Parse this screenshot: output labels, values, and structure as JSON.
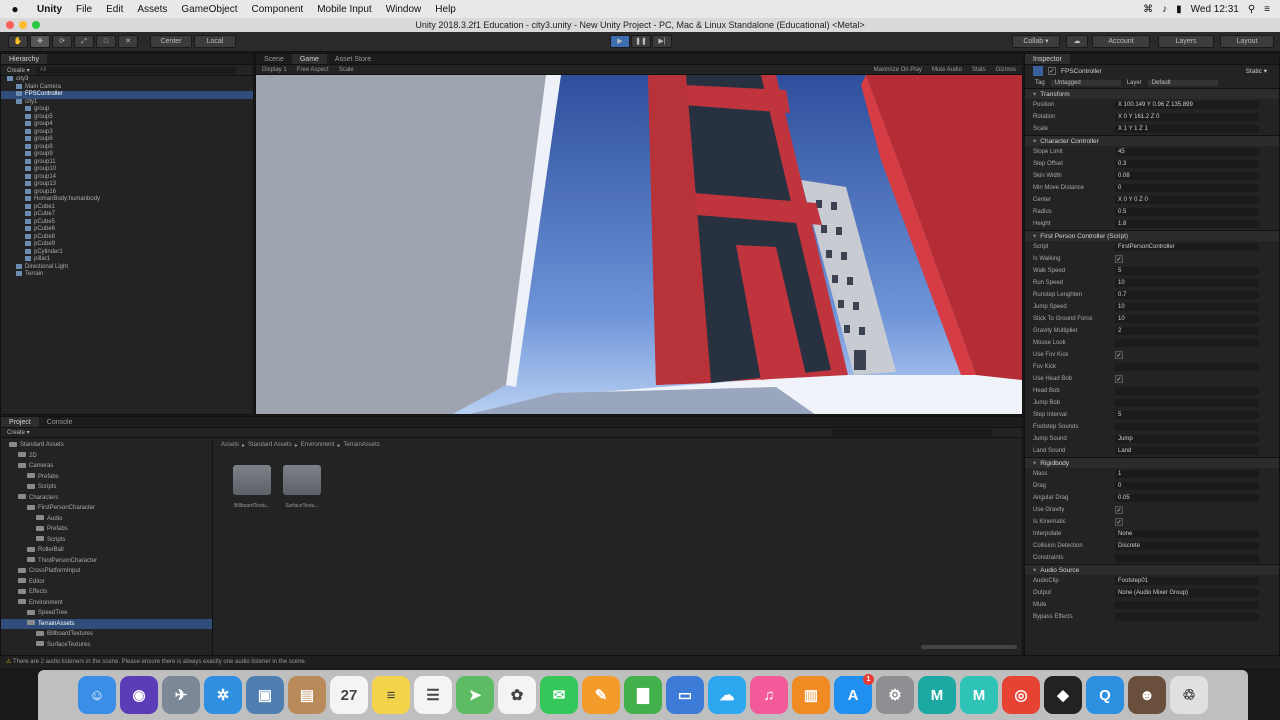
{
  "menubar": {
    "apple": "",
    "app": "Unity",
    "items": [
      "File",
      "Edit",
      "Assets",
      "GameObject",
      "Component",
      "Mobile Input",
      "Window",
      "Help"
    ],
    "clock": "Wed 12:31"
  },
  "window": {
    "title": "Unity 2018.3.2f1 Education - city3.unity - New Unity Project - PC, Mac & Linux Standalone (Educational) <Metal>"
  },
  "toolbar": {
    "center_label": "Center",
    "local_label": "Local",
    "collab_label": "Collab ▾",
    "account_label": "Account",
    "layers_label": "Layers",
    "layout_label": "Layout"
  },
  "hierarchy": {
    "tab": "Hierarchy",
    "create": "Create ▾",
    "search_placeholder": "All",
    "items": [
      {
        "label": "city3",
        "indent": 0,
        "selected": false
      },
      {
        "label": "Main Camera",
        "indent": 1,
        "selected": false
      },
      {
        "label": "FPSController",
        "indent": 1,
        "selected": true
      },
      {
        "label": "city1",
        "indent": 1,
        "selected": false
      },
      {
        "label": "group",
        "indent": 2,
        "selected": false
      },
      {
        "label": "group5",
        "indent": 2,
        "selected": false
      },
      {
        "label": "group4",
        "indent": 2,
        "selected": false
      },
      {
        "label": "group3",
        "indent": 2,
        "selected": false
      },
      {
        "label": "group6",
        "indent": 2,
        "selected": false
      },
      {
        "label": "group8",
        "indent": 2,
        "selected": false
      },
      {
        "label": "group9",
        "indent": 2,
        "selected": false
      },
      {
        "label": "group11",
        "indent": 2,
        "selected": false
      },
      {
        "label": "group10",
        "indent": 2,
        "selected": false
      },
      {
        "label": "group14",
        "indent": 2,
        "selected": false
      },
      {
        "label": "group13",
        "indent": 2,
        "selected": false
      },
      {
        "label": "group16",
        "indent": 2,
        "selected": false
      },
      {
        "label": "HumanBody:humanbody",
        "indent": 2,
        "selected": false
      },
      {
        "label": "pCube1",
        "indent": 2,
        "selected": false
      },
      {
        "label": "pCube7",
        "indent": 2,
        "selected": false
      },
      {
        "label": "pCube5",
        "indent": 2,
        "selected": false
      },
      {
        "label": "pCube6",
        "indent": 2,
        "selected": false
      },
      {
        "label": "pCube8",
        "indent": 2,
        "selected": false
      },
      {
        "label": "pCube9",
        "indent": 2,
        "selected": false
      },
      {
        "label": "pCylinder1",
        "indent": 2,
        "selected": false
      },
      {
        "label": "pillar1",
        "indent": 2,
        "selected": false
      },
      {
        "label": "Directional Light",
        "indent": 1,
        "selected": false
      },
      {
        "label": "Terrain",
        "indent": 1,
        "selected": false
      }
    ]
  },
  "sceneview": {
    "tabs": [
      "Scene",
      "Game",
      "Asset Store"
    ],
    "active_tab": "Game",
    "display": "Display 1",
    "aspect": "Free Aspect",
    "scale_label": "Scale",
    "maximize": "Maximize On Play",
    "mute": "Mute Audio",
    "stats": "Stats",
    "gizmos": "Gizmos"
  },
  "project": {
    "tabs": [
      "Project",
      "Console"
    ],
    "create": "Create ▾",
    "tree": [
      {
        "label": "Standard Assets",
        "indent": 0
      },
      {
        "label": "2D",
        "indent": 1
      },
      {
        "label": "Cameras",
        "indent": 1
      },
      {
        "label": "Prefabs",
        "indent": 2
      },
      {
        "label": "Scripts",
        "indent": 2
      },
      {
        "label": "Characters",
        "indent": 1
      },
      {
        "label": "FirstPersonCharacter",
        "indent": 2
      },
      {
        "label": "Audio",
        "indent": 3
      },
      {
        "label": "Prefabs",
        "indent": 3
      },
      {
        "label": "Scripts",
        "indent": 3
      },
      {
        "label": "RollerBall",
        "indent": 2
      },
      {
        "label": "ThirdPersonCharacter",
        "indent": 2
      },
      {
        "label": "CrossPlatformInput",
        "indent": 1
      },
      {
        "label": "Editor",
        "indent": 1
      },
      {
        "label": "Effects",
        "indent": 1
      },
      {
        "label": "Environment",
        "indent": 1
      },
      {
        "label": "SpeedTree",
        "indent": 2
      },
      {
        "label": "TerrainAssets",
        "indent": 2
      },
      {
        "label": "BillboardTextures",
        "indent": 3
      },
      {
        "label": "SurfaceTextures",
        "indent": 3
      }
    ],
    "breadcrumb": [
      "Assets",
      "Standard Assets",
      "Environment",
      "TerrainAssets"
    ],
    "folders": [
      "BillboardTextu...",
      "SurfaceTextu..."
    ]
  },
  "status": {
    "message": "There are 2 audio listeners in the scene. Please ensure there is always exactly one audio listener in the scene."
  },
  "inspector": {
    "tab": "Inspector",
    "object_name": "FPSController",
    "static": "Static ▾",
    "tag_label": "Tag",
    "tag_value": "Untagged",
    "layer_label": "Layer",
    "layer_value": "Default",
    "components": [
      {
        "title": "Transform",
        "rows": [
          {
            "label": "Position",
            "value": "X 100.149   Y 0.96    Z 135.899"
          },
          {
            "label": "Rotation",
            "value": "X 0       Y 161.2   Z 0"
          },
          {
            "label": "Scale",
            "value": "X 1       Y 1       Z 1"
          }
        ]
      },
      {
        "title": "Character Controller",
        "rows": [
          {
            "label": "Slope Limit",
            "value": "45"
          },
          {
            "label": "Step Offset",
            "value": "0.3"
          },
          {
            "label": "Skin Width",
            "value": "0.08"
          },
          {
            "label": "Min Move Distance",
            "value": "0"
          },
          {
            "label": "Center",
            "value": "X 0       Y 0       Z 0"
          },
          {
            "label": "Radius",
            "value": "0.5"
          },
          {
            "label": "Height",
            "value": "1.8"
          }
        ]
      },
      {
        "title": "First Person Controller (Script)",
        "rows": [
          {
            "label": "Script",
            "value": "FirstPersonController"
          },
          {
            "label": "Is Walking",
            "value": "✓",
            "check": true
          },
          {
            "label": "Walk Speed",
            "value": "5"
          },
          {
            "label": "Run Speed",
            "value": "10"
          },
          {
            "label": "Runstep Lenghten",
            "value": "0.7"
          },
          {
            "label": "Jump Speed",
            "value": "10"
          },
          {
            "label": "Stick To Ground Force",
            "value": "10"
          },
          {
            "label": "Gravity Multiplier",
            "value": "2"
          },
          {
            "label": "Mouse Look",
            "value": ""
          },
          {
            "label": "Use Fov Kick",
            "value": "✓",
            "check": true
          },
          {
            "label": "Fov Kick",
            "value": ""
          },
          {
            "label": "Use Head Bob",
            "value": "✓",
            "check": true
          },
          {
            "label": "Head Bob",
            "value": ""
          },
          {
            "label": "Jump Bob",
            "value": ""
          },
          {
            "label": "Step Interval",
            "value": "5"
          },
          {
            "label": "Footstep Sounds",
            "value": ""
          },
          {
            "label": "Jump Sound",
            "value": "Jump"
          },
          {
            "label": "Land Sound",
            "value": "Land"
          }
        ]
      },
      {
        "title": "Rigidbody",
        "rows": [
          {
            "label": "Mass",
            "value": "1"
          },
          {
            "label": "Drag",
            "value": "0"
          },
          {
            "label": "Angular Drag",
            "value": "0.05"
          },
          {
            "label": "Use Gravity",
            "value": "✓",
            "check": true
          },
          {
            "label": "Is Kinematic",
            "value": "✓",
            "check": true
          },
          {
            "label": "Interpolate",
            "value": "None"
          },
          {
            "label": "Collision Detection",
            "value": "Discrete"
          },
          {
            "label": "Constraints",
            "value": ""
          }
        ]
      },
      {
        "title": "Audio Source",
        "rows": [
          {
            "label": "AudioClip",
            "value": "Footstep01"
          },
          {
            "label": "Output",
            "value": "None (Audio Mixer Group)"
          },
          {
            "label": "Mute",
            "value": ""
          },
          {
            "label": "Bypass Effects",
            "value": ""
          }
        ]
      }
    ]
  },
  "dock": {
    "icons": [
      {
        "name": "finder-icon",
        "color": "#3a8ee6",
        "glyph": "☺"
      },
      {
        "name": "siri-icon",
        "color": "#5b3db8",
        "glyph": "◉"
      },
      {
        "name": "launchpad-icon",
        "color": "#7c8798",
        "glyph": "✈"
      },
      {
        "name": "safari-icon",
        "color": "#2f8fe0",
        "glyph": "✲"
      },
      {
        "name": "photo-browser-icon",
        "color": "#4f7eb0",
        "glyph": "▣"
      },
      {
        "name": "contacts-icon",
        "color": "#b98a5a",
        "glyph": "▤"
      },
      {
        "name": "calendar-icon",
        "color": "#f4f4f4",
        "glyph": "27"
      },
      {
        "name": "notes-icon",
        "color": "#f3d34a",
        "glyph": "≡"
      },
      {
        "name": "reminders-icon",
        "color": "#f4f4f4",
        "glyph": "☰"
      },
      {
        "name": "maps-icon",
        "color": "#5dbb63",
        "glyph": "➤"
      },
      {
        "name": "photos-icon",
        "color": "#f4f4f4",
        "glyph": "✿"
      },
      {
        "name": "messages-icon",
        "color": "#34c759",
        "glyph": "✉"
      },
      {
        "name": "pages-icon",
        "color": "#f39c2b",
        "glyph": "✎"
      },
      {
        "name": "numbers-icon",
        "color": "#43b14b",
        "glyph": "▇"
      },
      {
        "name": "keynote-icon",
        "color": "#3d7bd8",
        "glyph": "▭"
      },
      {
        "name": "facetime-icon",
        "color": "#2da8f0",
        "glyph": "☁"
      },
      {
        "name": "itunes-icon",
        "color": "#f25a9a",
        "glyph": "♫"
      },
      {
        "name": "books-icon",
        "color": "#f08b23",
        "glyph": "▥"
      },
      {
        "name": "app-store-icon",
        "color": "#1f8ff0",
        "glyph": "A",
        "badge": "1"
      },
      {
        "name": "system-preferences-icon",
        "color": "#8e8e93",
        "glyph": "⚙"
      },
      {
        "name": "maya-icon",
        "color": "#1ca9a3",
        "glyph": "M"
      },
      {
        "name": "maya-2-icon",
        "color": "#2fc2b6",
        "glyph": "M"
      },
      {
        "name": "chrome-icon",
        "color": "#e64335",
        "glyph": "◎"
      },
      {
        "name": "unity-icon",
        "color": "#222222",
        "glyph": "◆"
      },
      {
        "name": "quicktime-icon",
        "color": "#2c8fe0",
        "glyph": "Q"
      },
      {
        "name": "user-photo-icon",
        "color": "#6a4f3c",
        "glyph": "☻"
      },
      {
        "name": "trash-icon",
        "color": "#e0e0e0",
        "glyph": "♲"
      }
    ]
  }
}
